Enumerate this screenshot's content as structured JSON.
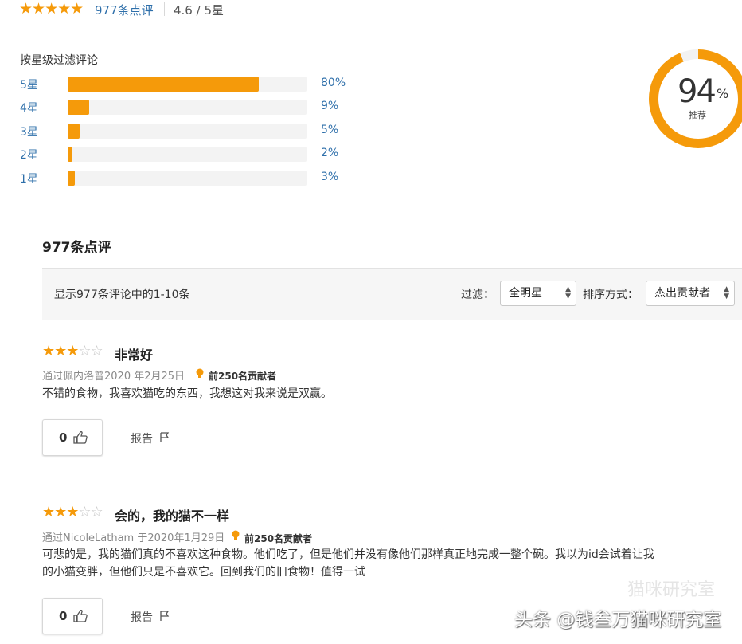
{
  "summary": {
    "stars_glyph": "★★★★★",
    "review_count_link": "977条点评",
    "rating_text": "4.6 / 5星",
    "rating_value": 4.6
  },
  "filter_by_star": {
    "title": "按星级过滤评论",
    "rows": [
      {
        "label": "5星",
        "pct_text": "80%",
        "pct": 80
      },
      {
        "label": "4星",
        "pct_text": "9%",
        "pct": 9
      },
      {
        "label": "3星",
        "pct_text": "5%",
        "pct": 5
      },
      {
        "label": "2星",
        "pct_text": "2%",
        "pct": 2
      },
      {
        "label": "1星",
        "pct_text": "3%",
        "pct": 3
      }
    ]
  },
  "recommend": {
    "value": "94",
    "unit": "%",
    "label": "推荐",
    "fraction": 0.94
  },
  "reviews_header": {
    "title": "977条点评"
  },
  "toolbar": {
    "showing_text": "显示977条评论中的1-10条",
    "filter_label": "过滤：",
    "filter_value": "全明星",
    "sort_label": "排序方式：",
    "sort_value": "杰出贡献者"
  },
  "reviews": [
    {
      "stars": 3,
      "title": "非常好",
      "meta": "通过佩内洛普2020 年2月25日",
      "badge": "前250名贡献者",
      "body": "不错的食物，我喜欢猫吃的东西，我想这对我来说是双赢。",
      "helpful_count": "0",
      "report_label": "报告"
    },
    {
      "stars": 3,
      "title": "会的，我的猫不一样",
      "meta": "通过NicoleLatham 于2020年1月29日",
      "badge": "前250名贡献者",
      "body_line1": "可悲的是，我的猫们真的不喜欢这种食物。他们吃了，但是他们并没有像他们那样真正地完成一整个碗。我以为id会试着让我",
      "body_line2": "的小猫变胖，但他们只是不喜欢它。回到我们的旧食物！值得一试",
      "helpful_count": "0",
      "report_label": "报告"
    }
  ],
  "watermark": {
    "text": "头条 @钱叁万猫咪研究室",
    "faint": "猫咪研究室"
  },
  "colors": {
    "accent": "#f59a0a",
    "link": "#2e6faa"
  }
}
